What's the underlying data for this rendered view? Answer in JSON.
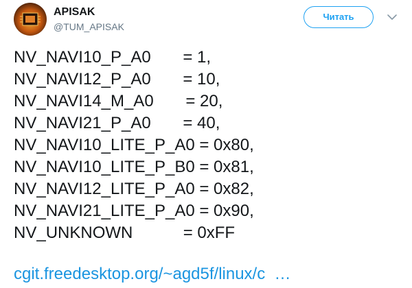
{
  "author": {
    "display_name": "APISAK",
    "handle": "@TUM_APISAK",
    "avatar_icon": "gpu-chip-avatar"
  },
  "follow_button": {
    "label": "Читать"
  },
  "menu_icon": "chevron-down-icon",
  "tweet": {
    "lines": [
      "NV_NAVI10_P_A0       = 1,",
      "NV_NAVI12_P_A0       = 10,",
      "NV_NAVI14_M_A0       = 20,",
      "NV_NAVI21_P_A0       = 40,",
      "NV_NAVI10_LITE_P_A0 = 0x80,",
      "NV_NAVI10_LITE_P_B0 = 0x81,",
      "NV_NAVI12_LITE_P_A0 = 0x82,",
      "NV_NAVI21_LITE_P_A0 = 0x90,",
      "NV_UNKNOWN           = 0xFF"
    ],
    "link_text": "cgit.freedesktop.org/~agd5f/linux/c  …"
  },
  "colors": {
    "accent": "#1da1f2",
    "link": "#1b95e0",
    "text": "#14171a",
    "muted": "#657786"
  }
}
